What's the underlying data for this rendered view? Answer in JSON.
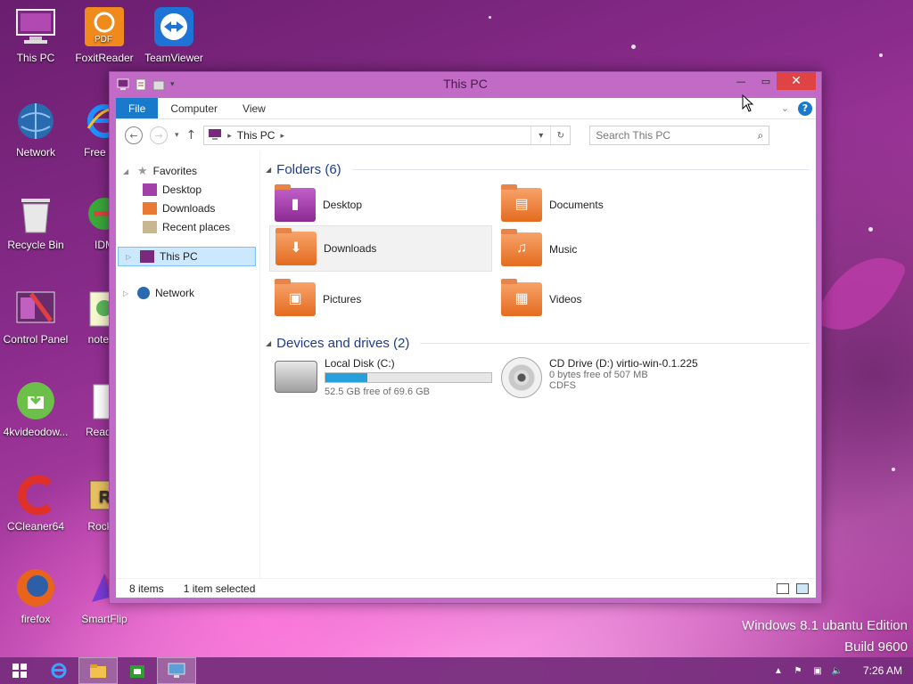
{
  "desktop": {
    "icons": [
      {
        "label": "This PC",
        "icon": "computer-icon"
      },
      {
        "label": "FoxitReader",
        "icon": "pdf-icon"
      },
      {
        "label": "TeamViewer",
        "icon": "teamviewer-icon"
      },
      {
        "label": "Network",
        "icon": "network-globe-icon"
      },
      {
        "label": "Free Sof",
        "icon": "internet-explorer-icon"
      },
      {
        "label": "Recycle Bin",
        "icon": "recycle-bin-icon"
      },
      {
        "label": "IDM",
        "icon": "idm-icon"
      },
      {
        "label": "Control Panel",
        "icon": "control-panel-icon"
      },
      {
        "label": "notepa",
        "icon": "notepad-icon"
      },
      {
        "label": "4kvideodow...",
        "icon": "download-cloud-icon"
      },
      {
        "label": "Read M",
        "icon": "document-icon"
      },
      {
        "label": "CCleaner64",
        "icon": "ccleaner-icon"
      },
      {
        "label": "Rocket",
        "icon": "rocket-icon"
      },
      {
        "label": "firefox",
        "icon": "firefox-icon"
      },
      {
        "label": "SmartFlip",
        "icon": "smartflip-icon"
      }
    ],
    "watermark_line1": "Windows 8.1 ubantu Edition",
    "watermark_line2": "Build 9600"
  },
  "window": {
    "title": "This PC",
    "ribbon_tabs": [
      "File",
      "Computer",
      "View"
    ],
    "address": "This PC",
    "search_placeholder": "Search This PC",
    "nav": {
      "favorites": "Favorites",
      "favorites_items": [
        "Desktop",
        "Downloads",
        "Recent places"
      ],
      "this_pc": "This PC",
      "network": "Network"
    },
    "folders_header": "Folders (6)",
    "folders": [
      {
        "name": "Desktop",
        "icon": "desktop-folder-icon"
      },
      {
        "name": "Documents",
        "icon": "documents-folder-icon"
      },
      {
        "name": "Downloads",
        "icon": "downloads-folder-icon"
      },
      {
        "name": "Music",
        "icon": "music-folder-icon"
      },
      {
        "name": "Pictures",
        "icon": "pictures-folder-icon"
      },
      {
        "name": "Videos",
        "icon": "videos-folder-icon"
      }
    ],
    "devices_header": "Devices and drives (2)",
    "drives": [
      {
        "name": "Local Disk (C:)",
        "free_text": "52.5 GB free of 69.6 GB",
        "used_fraction": 0.25
      },
      {
        "name": "CD Drive (D:) virtio-win-0.1.225",
        "free_text": "0 bytes free of 507 MB",
        "fs": "CDFS"
      }
    ],
    "status_items": "8 items",
    "status_selected": "1 item selected"
  },
  "taskbar": {
    "time": "7:26 AM",
    "apps": [
      "start-icon",
      "internet-explorer-icon",
      "file-explorer-icon",
      "store-icon",
      "this-pc-icon"
    ]
  },
  "colors": {
    "accent": "#1979ca",
    "window_frame": "#c26bc6",
    "close": "#e04343",
    "drive_bar": "#26a0da"
  }
}
